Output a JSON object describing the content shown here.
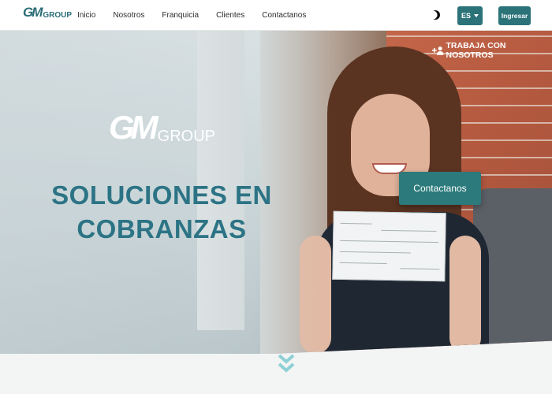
{
  "header": {
    "logo": {
      "mark": "GM",
      "word": "GROUP"
    },
    "nav": [
      "Inicio",
      "Nosotros",
      "Franquicia",
      "Clientes",
      "Contactanos"
    ],
    "theme_icon": "moon-icon",
    "language": "ES",
    "login_label": "Ingresar"
  },
  "hero": {
    "careers_link": "TRABAJA CON NOSOTROS",
    "careers_icon": "user-plus-icon",
    "logo": {
      "mark": "GM",
      "word": "GROUP"
    },
    "headline_line1": "SOLUCIONES EN",
    "headline_line2": "COBRANZAS",
    "cta_label": "Contactanos",
    "scroll_icon": "double-chevron-down-icon"
  },
  "colors": {
    "brand": "#2b7379",
    "headline": "#2c7485",
    "accent_light": "#8fd0d6"
  }
}
